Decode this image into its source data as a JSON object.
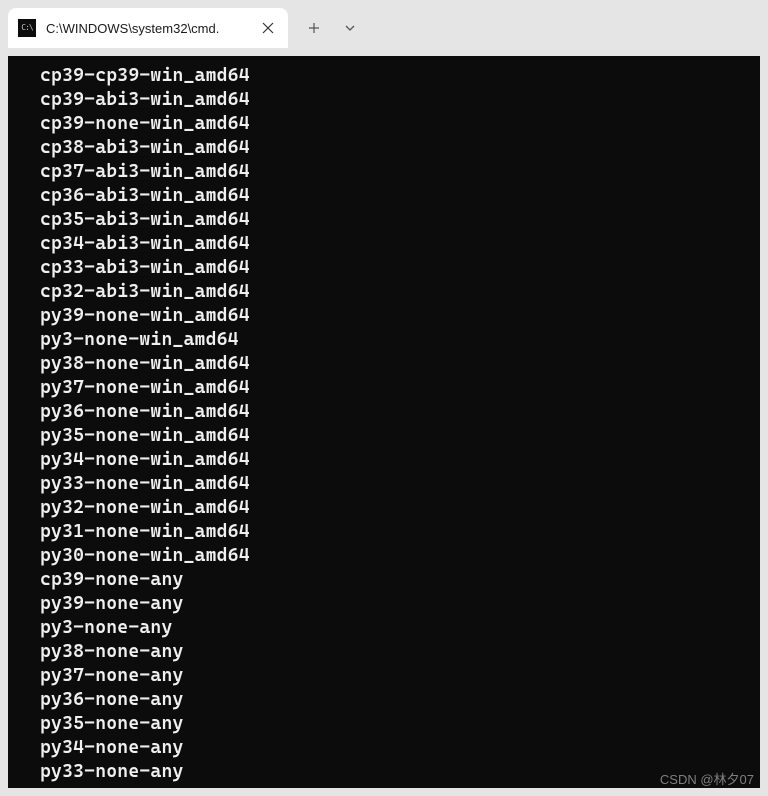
{
  "tab": {
    "title": "C:\\WINDOWS\\system32\\cmd."
  },
  "terminal": {
    "lines": [
      "cp39-cp39-win_amd64",
      "cp39-abi3-win_amd64",
      "cp39-none-win_amd64",
      "cp38-abi3-win_amd64",
      "cp37-abi3-win_amd64",
      "cp36-abi3-win_amd64",
      "cp35-abi3-win_amd64",
      "cp34-abi3-win_amd64",
      "cp33-abi3-win_amd64",
      "cp32-abi3-win_amd64",
      "py39-none-win_amd64",
      "py3-none-win_amd64",
      "py38-none-win_amd64",
      "py37-none-win_amd64",
      "py36-none-win_amd64",
      "py35-none-win_amd64",
      "py34-none-win_amd64",
      "py33-none-win_amd64",
      "py32-none-win_amd64",
      "py31-none-win_amd64",
      "py30-none-win_amd64",
      "cp39-none-any",
      "py39-none-any",
      "py3-none-any",
      "py38-none-any",
      "py37-none-any",
      "py36-none-any",
      "py35-none-any",
      "py34-none-any",
      "py33-none-any"
    ]
  },
  "watermark": "CSDN @林夕07"
}
